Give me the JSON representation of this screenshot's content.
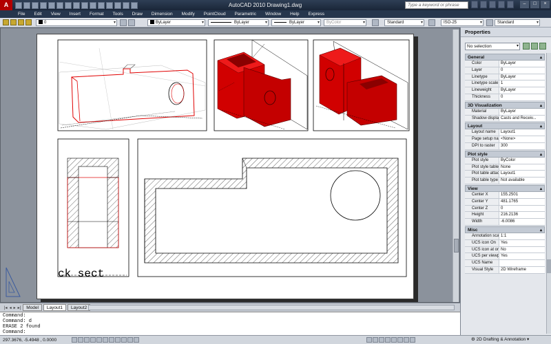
{
  "window": {
    "title": "AutoCAD 2010    Drawing1.dwg",
    "search_placeholder": "Type a keyword or phrase",
    "app_letter": "A"
  },
  "menu": [
    "File",
    "Edit",
    "View",
    "Insert",
    "Format",
    "Tools",
    "Draw",
    "Dimension",
    "Modify",
    "PointCloud",
    "Parametric",
    "Window",
    "Help",
    "Express"
  ],
  "toolbar": {
    "layer_value": "0",
    "color_value": "ByLayer",
    "linetype_value": "ByLayer",
    "lineweight_value": "ByLayer",
    "plotstyle_value": "ByColor",
    "textstyle_value": "Standard",
    "dimstyle_value": "ISO-25",
    "tablestyle_value": "Standard"
  },
  "drawing": {
    "section_text": "ck sect"
  },
  "tabs": {
    "model": "Model",
    "layout1": "Layout1",
    "layout2": "Layout2"
  },
  "command": {
    "lines": [
      "Command:",
      "Command: d",
      "ERASE 2 found",
      "Command:"
    ]
  },
  "status": {
    "coords": "297.3676, -5.4948 , 0.0000",
    "workspace": "2D Drafting & Annotation"
  },
  "properties": {
    "title": "Properties",
    "selection": "No selection",
    "sections": [
      {
        "name": "General",
        "rows": [
          {
            "k": "Color",
            "v": "ByLayer"
          },
          {
            "k": "Layer",
            "v": "0"
          },
          {
            "k": "Linetype",
            "v": "ByLayer"
          },
          {
            "k": "Linetype scale",
            "v": "1"
          },
          {
            "k": "Lineweight",
            "v": "ByLayer"
          },
          {
            "k": "Thickness",
            "v": "0"
          }
        ]
      },
      {
        "name": "3D Visualization",
        "rows": [
          {
            "k": "Material",
            "v": "ByLayer"
          },
          {
            "k": "Shadow display",
            "v": "Casts and Receiv..."
          }
        ]
      },
      {
        "name": "Layout",
        "rows": [
          {
            "k": "Layout name",
            "v": "Layout1"
          },
          {
            "k": "Page setup name",
            "v": "<None>"
          },
          {
            "k": "DPI to raster",
            "v": "300"
          }
        ]
      },
      {
        "name": "Plot style",
        "rows": [
          {
            "k": "Plot style",
            "v": "ByColor"
          },
          {
            "k": "Plot style table",
            "v": "None"
          },
          {
            "k": "Plot table attac...",
            "v": "Layout1"
          },
          {
            "k": "Plot table type",
            "v": "Not available"
          }
        ]
      },
      {
        "name": "View",
        "rows": [
          {
            "k": "Center X",
            "v": "155.2501"
          },
          {
            "k": "Center Y",
            "v": "481.1765"
          },
          {
            "k": "Center Z",
            "v": "0"
          },
          {
            "k": "Height",
            "v": "216.2136"
          },
          {
            "k": "Width",
            "v": "-6.0086"
          }
        ]
      },
      {
        "name": "Misc",
        "rows": [
          {
            "k": "Annotation scale",
            "v": "1:1"
          },
          {
            "k": "UCS icon On",
            "v": "Yes"
          },
          {
            "k": "UCS icon at origin",
            "v": "No"
          },
          {
            "k": "UCS per viewport",
            "v": "Yes"
          },
          {
            "k": "UCS Name",
            "v": ""
          },
          {
            "k": "Visual Style",
            "v": "2D Wireframe"
          }
        ]
      }
    ]
  },
  "colors": {
    "solid_red": "#d10000",
    "edge_red": "#e00000",
    "paper": "#ffffff",
    "canvas_bg": "#8b929c"
  }
}
